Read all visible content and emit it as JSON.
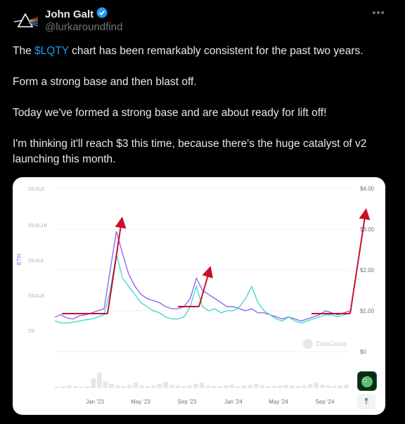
{
  "author": {
    "name": "John Galt",
    "handle": "@lurkaroundfind",
    "verified_icon": "verified-badge-icon",
    "avatar_icon": "prism-avatar-icon"
  },
  "menu": {
    "more_label": "•••"
  },
  "tweet": {
    "line1_pre": "The ",
    "cashtag": "$LQTY",
    "line1_post": " chart has been remarkably consistent for the past two years.",
    "line2": "Form a strong base and then blast off.",
    "line3": "Today we've formed a strong base and are about ready for lift off!",
    "line4": "I'm thinking it'll reach $3 this time, because there's the huge catalyst of v2 launching this month."
  },
  "chart": {
    "watermark": "CoinGecko",
    "left_axis_label": "ETH",
    "up_button": "⤒",
    "colors": {
      "eth_series": "#8b5cf6",
      "usd_series": "#3dd9c5",
      "arrows": "#c8102e",
      "volume": "#e5e7eb"
    }
  },
  "chart_data": {
    "type": "line",
    "title": "",
    "left_ticks": [
      "Ξ0.0₃2",
      "Ξ0.0₃15",
      "Ξ0.0₃1",
      "Ξ0.0₄5",
      "Ξ0"
    ],
    "right_ticks": [
      "$4.00",
      "$3.00",
      "$2.00",
      "$1.00",
      "$0"
    ],
    "x_ticks": [
      "Jan '23",
      "May '23",
      "Sep '23",
      "Jan '24",
      "May '24",
      "Sep '24"
    ],
    "ylim_usd": [
      0,
      4
    ],
    "series": [
      {
        "name": "ETH",
        "values": [
          0.85,
          0.9,
          0.82,
          0.8,
          0.88,
          0.9,
          0.95,
          1.0,
          1.05,
          2.0,
          2.95,
          2.4,
          1.9,
          1.6,
          1.4,
          1.3,
          1.25,
          1.2,
          1.1,
          1.05,
          1.05,
          1.1,
          1.3,
          1.8,
          1.5,
          1.4,
          1.3,
          1.2,
          1.1,
          1.1,
          1.05,
          1.0,
          1.05,
          0.95,
          0.95,
          0.9,
          0.85,
          0.8,
          0.85,
          0.8,
          0.75,
          0.8,
          0.85,
          0.9,
          1.0,
          0.95,
          0.9,
          0.95,
          1.0
        ]
      },
      {
        "name": "USD",
        "values": [
          0.75,
          0.7,
          0.7,
          0.72,
          0.75,
          0.78,
          0.8,
          0.85,
          0.9,
          1.5,
          2.4,
          1.8,
          1.6,
          1.4,
          1.2,
          1.1,
          1.0,
          0.95,
          0.85,
          0.8,
          0.8,
          0.85,
          1.1,
          1.6,
          1.1,
          1.0,
          1.05,
          0.95,
          1.0,
          1.0,
          1.1,
          1.3,
          1.6,
          1.2,
          1.0,
          0.9,
          0.8,
          0.75,
          0.85,
          0.75,
          0.7,
          0.75,
          0.8,
          0.85,
          0.9,
          0.9,
          0.85,
          0.9,
          0.95
        ]
      }
    ]
  }
}
